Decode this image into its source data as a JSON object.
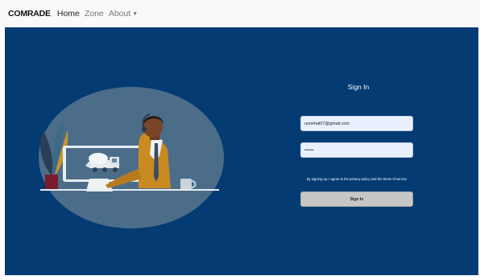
{
  "navbar": {
    "brand": "COMRADE",
    "links": [
      {
        "label": "Home"
      },
      {
        "label": "Zone"
      },
      {
        "label": "About"
      }
    ],
    "dropdown_caret": "▼"
  },
  "signin": {
    "title": "Sign In",
    "email_value": "usnehal07@gmail.com",
    "password_value": "••••••",
    "terms_text": "By signing up, I agree to the privacy policy and the terms of service",
    "button_label": "Sign In"
  },
  "colors": {
    "panel_background": "#033b72",
    "illustration_circle": "#4b6d8a",
    "input_background": "#e8f0fe",
    "button_background": "#c7c7c7",
    "navbar_background": "#f8f9fa"
  },
  "icons": {
    "illustration": "person-at-computer-illustration",
    "monitor_image": "cement-mixer-truck-icon"
  }
}
